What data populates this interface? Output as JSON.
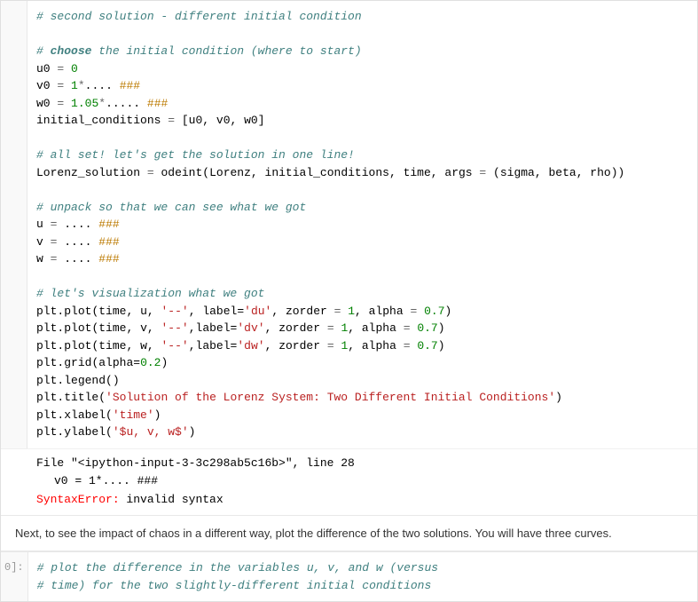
{
  "code_cell": {
    "lines": [
      {
        "id": "line1",
        "content": "# second solution - different initial condition",
        "type": "comment"
      },
      {
        "id": "line2",
        "content": "",
        "type": "blank"
      },
      {
        "id": "line3",
        "content": "# choose the initial condition (where to start)",
        "type": "comment"
      },
      {
        "id": "line4",
        "content": "u0 = 0",
        "type": "code"
      },
      {
        "id": "line5",
        "content": "v0 = 1*.... ###",
        "type": "code_hash"
      },
      {
        "id": "line6",
        "content": "w0 = 1.05*.... ###",
        "type": "code_hash"
      },
      {
        "id": "line7",
        "content": "initial_conditions = [u0, v0, w0]",
        "type": "code"
      },
      {
        "id": "line8",
        "content": "",
        "type": "blank"
      },
      {
        "id": "line9",
        "content": "# all set! let's get the solution in one line!",
        "type": "comment"
      },
      {
        "id": "line10",
        "content": "Lorenz_solution = odeint(Lorenz, initial_conditions, time, args = (sigma, beta, rho))",
        "type": "code"
      },
      {
        "id": "line11",
        "content": "",
        "type": "blank"
      },
      {
        "id": "line12",
        "content": "# unpack so that we can see what we got",
        "type": "comment"
      },
      {
        "id": "line13",
        "content": "u = .... ###",
        "type": "code_hash"
      },
      {
        "id": "line14",
        "content": "v = .... ###",
        "type": "code_hash"
      },
      {
        "id": "line15",
        "content": "w = .... ###",
        "type": "code_hash"
      },
      {
        "id": "line16",
        "content": "",
        "type": "blank"
      },
      {
        "id": "line17",
        "content": "# let's visualization what we got",
        "type": "comment"
      },
      {
        "id": "line18",
        "content": "plt.plot(time, u, '--', label='du', zorder = 1, alpha = 0.7)",
        "type": "code"
      },
      {
        "id": "line19",
        "content": "plt.plot(time, v, '--',label='dv', zorder = 1, alpha = 0.7)",
        "type": "code"
      },
      {
        "id": "line20",
        "content": "plt.plot(time, w, '--',label='dw', zorder = 1, alpha = 0.7)",
        "type": "code"
      },
      {
        "id": "line21",
        "content": "plt.grid(alpha=0.2)",
        "type": "code"
      },
      {
        "id": "line22",
        "content": "plt.legend()",
        "type": "code"
      },
      {
        "id": "line23",
        "content": "plt.title('Solution of the Lorenz System: Two Different Initial Conditions')",
        "type": "code"
      },
      {
        "id": "line24",
        "content": "plt.xlabel('time')",
        "type": "code"
      },
      {
        "id": "line25",
        "content": "plt.ylabel('$u, v, w$')",
        "type": "code"
      }
    ]
  },
  "error_output": {
    "file_line": "File \"<ipython-input-3-3c298ab5c16b>\", line 28",
    "code_line": "    v0 = 1*.... ###",
    "error_type": "SyntaxError:",
    "error_message": " invalid syntax"
  },
  "text_cell": {
    "content": "Next, to see the impact of chaos in a different way, plot the difference of the two solutions. You will have three curves."
  },
  "next_cell": {
    "label": "0]:",
    "lines": [
      "# plot the difference in the variables u, v, and w (versus",
      "# time) for the two slightly-different initial conditions"
    ]
  }
}
